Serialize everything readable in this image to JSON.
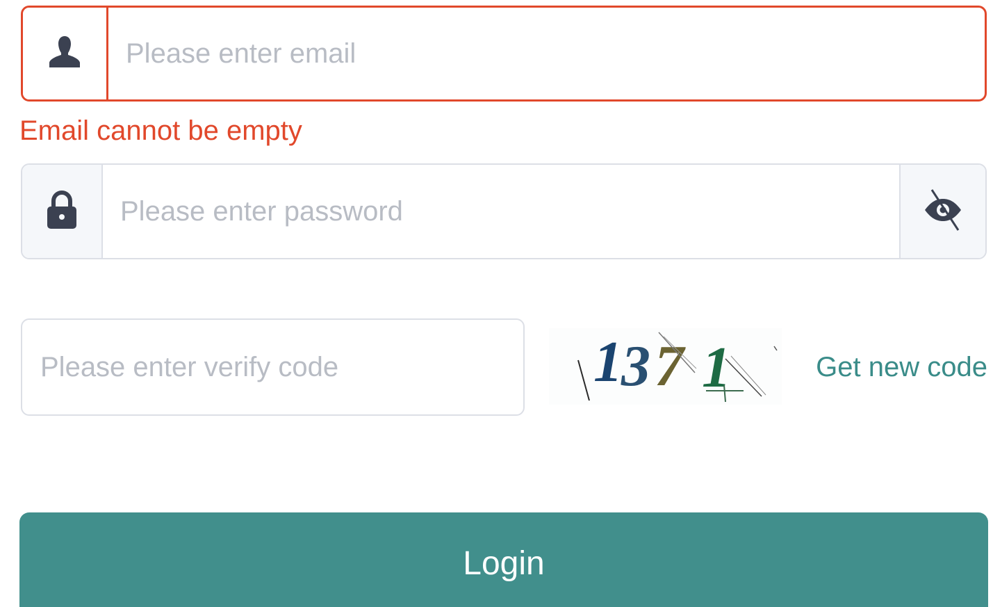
{
  "email": {
    "placeholder": "Please enter email",
    "value": "",
    "icon": "user-icon",
    "error": "Email cannot be empty"
  },
  "password": {
    "placeholder": "Please enter password",
    "value": "",
    "icon": "lock-icon",
    "toggle_icon": "eye-slash-icon"
  },
  "verify": {
    "placeholder": "Please enter verify code",
    "value": "",
    "captcha_text": "1371",
    "new_code_label": "Get new code"
  },
  "login": {
    "label": "Login"
  },
  "colors": {
    "error": "#e1482b",
    "accent": "#418f8c",
    "link": "#3a8c89",
    "placeholder": "#b8bcc4",
    "border": "#dcdfe6"
  }
}
